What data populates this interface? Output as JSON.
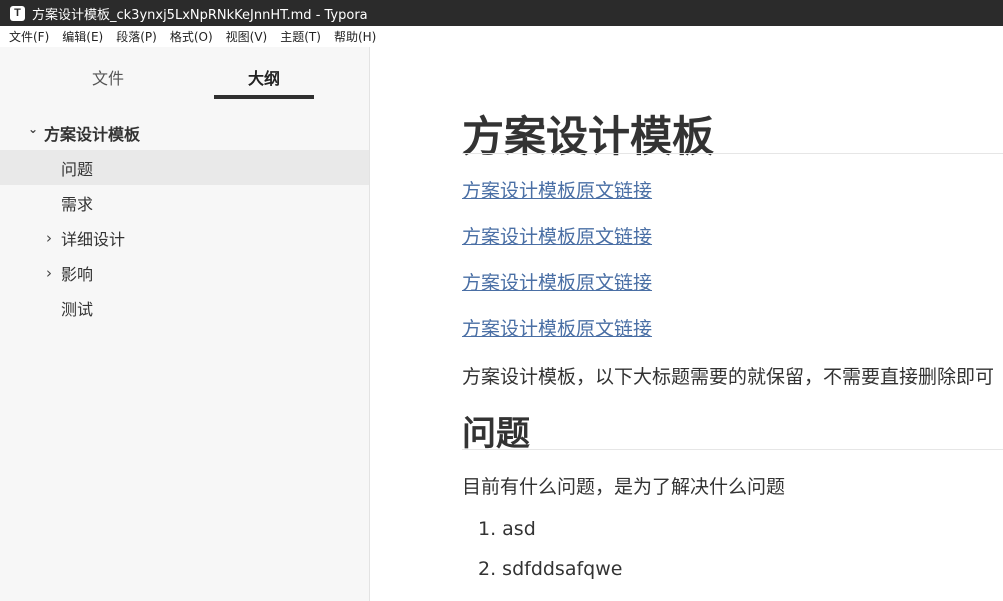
{
  "window": {
    "app_icon": "T",
    "title": "方案设计模板_ck3ynxj5LxNpRNkKeJnnHT.md - Typora"
  },
  "menu": [
    "文件(F)",
    "编辑(E)",
    "段落(P)",
    "格式(O)",
    "视图(V)",
    "主题(T)",
    "帮助(H)"
  ],
  "sidebar": {
    "tabs": {
      "files": "文件",
      "outline": "大纲"
    },
    "outline": [
      {
        "label": "方案设计模板",
        "chevron": "⌄"
      },
      {
        "label": "问题",
        "chevron": ""
      },
      {
        "label": "需求",
        "chevron": ""
      },
      {
        "label": "详细设计",
        "chevron": "›"
      },
      {
        "label": "影响",
        "chevron": "›"
      },
      {
        "label": "测试",
        "chevron": ""
      }
    ]
  },
  "doc": {
    "h1": "方案设计模板",
    "links": [
      "方案设计模板原文链接",
      "方案设计模板原文链接",
      "方案设计模板原文链接",
      "方案设计模板原文链接"
    ],
    "intro": "方案设计模板，以下大标题需要的就保留，不需要直接删除即可",
    "h2": "问题",
    "p2": "目前有什么问题，是为了解决什么问题",
    "list": [
      "1. asd",
      "2. sdfddsafqwe"
    ]
  }
}
